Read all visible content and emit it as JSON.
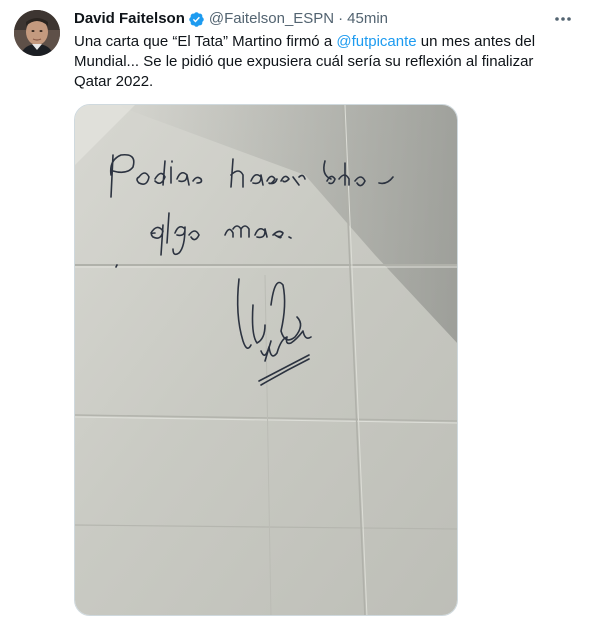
{
  "tweet": {
    "author_name": "David Faitelson",
    "handle": "@Faitelson_ESPN",
    "separator": "·",
    "time": "45min",
    "text_part1": "Una carta que “El Tata” Martino firmó a ",
    "mention": "@futpicante",
    "text_part2": " un mes antes del Mundial... Se le pidió que expusiera cuál sería su reflexión al finalizar Qatar 2022.",
    "icons": {
      "verified": "verified-badge-icon",
      "more": "more-options-icon"
    },
    "colors": {
      "accent": "#1d9bf0",
      "secondary_text": "#536471",
      "paper": "#c9c9c2"
    }
  }
}
